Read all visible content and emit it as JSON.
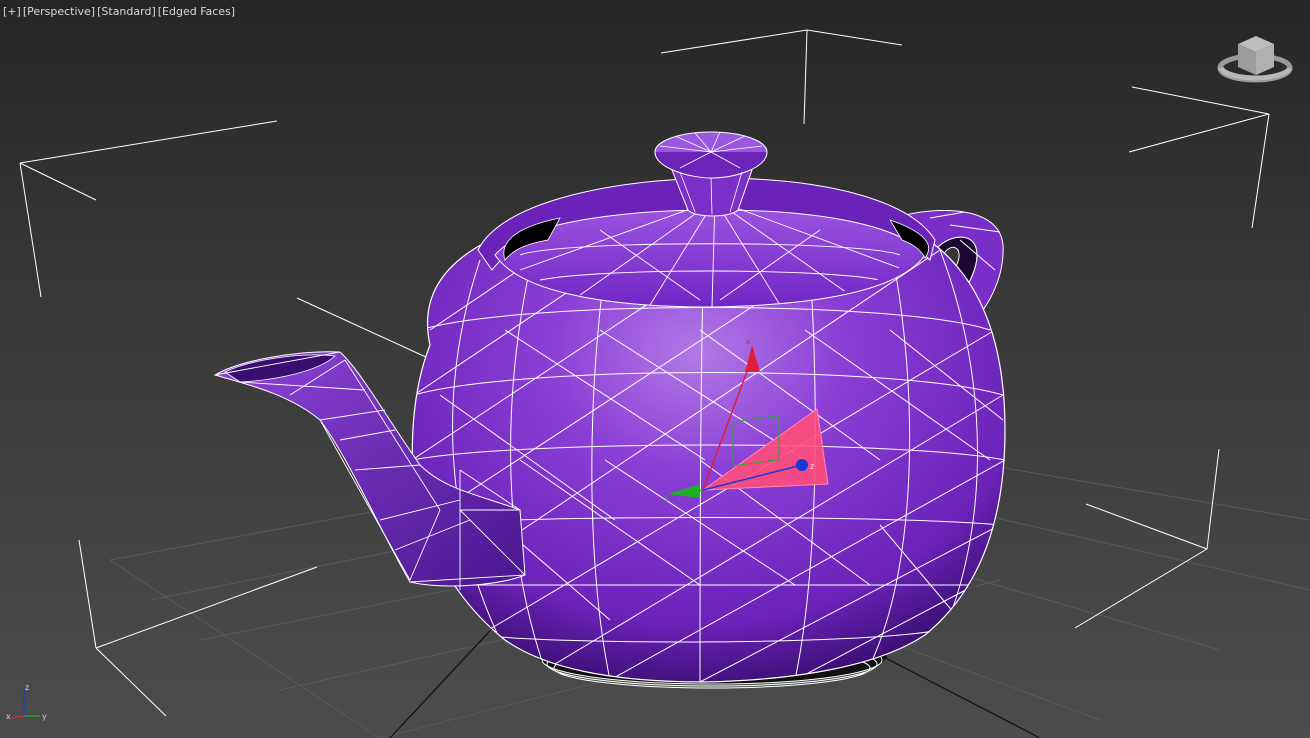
{
  "viewport": {
    "labels": [
      {
        "text": "[+]"
      },
      {
        "text": "[Perspective]"
      },
      {
        "text": "[Standard]"
      },
      {
        "text": "[Edged Faces]"
      }
    ],
    "view_cube_icon": "view-cube-icon",
    "axis_tripod": {
      "x": "x",
      "y": "y",
      "z": "z"
    },
    "gizmo_axes": {
      "x": "x",
      "y": "y",
      "z": "z"
    }
  },
  "object": {
    "name_icon": "teapot-mesh",
    "color": "#7b2fc9",
    "edge_color": "#ffffff"
  },
  "colors": {
    "background_top": "#262626",
    "background_bottom": "#4c4c4c",
    "grid": "#5a5a5a",
    "axis_x": "#e0203a",
    "axis_y": "#1fae2a",
    "axis_z": "#1a3ad6",
    "gizmo_plane": "#ff4d7a"
  }
}
